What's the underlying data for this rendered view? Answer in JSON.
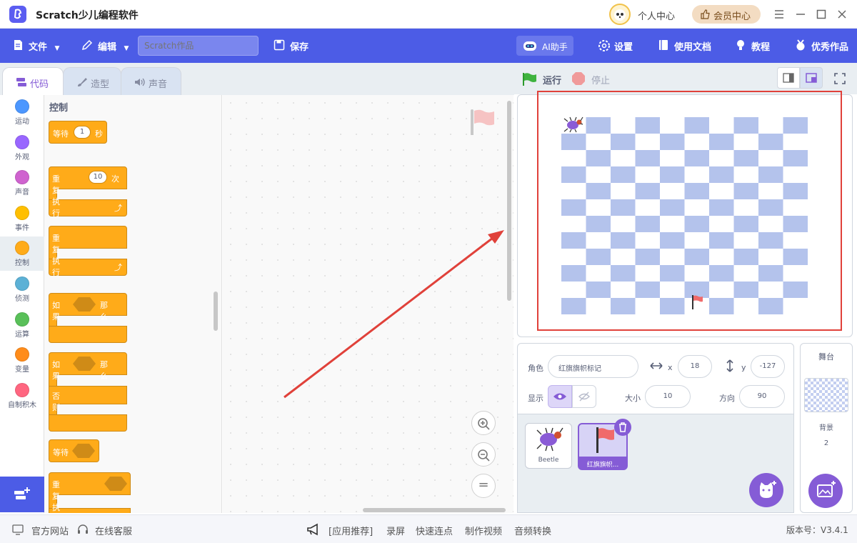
{
  "titlebar": {
    "app_title": "Scratch少儿编程软件",
    "user_center": "个人中心",
    "vip_center": "会员中心"
  },
  "menubar": {
    "file": "文件",
    "edit": "编辑",
    "project_name_placeholder": "Scratch作品",
    "save": "保存",
    "ai_assistant": "AI助手",
    "settings": "设置",
    "docs": "使用文档",
    "tutorial": "教程",
    "showcase": "优秀作品"
  },
  "tabs": [
    {
      "label": "代码"
    },
    {
      "label": "造型"
    },
    {
      "label": "声音"
    }
  ],
  "categories": [
    {
      "label": "运动",
      "color": "#4c97ff"
    },
    {
      "label": "外观",
      "color": "#9966ff"
    },
    {
      "label": "声音",
      "color": "#cf63cf"
    },
    {
      "label": "事件",
      "color": "#ffbf00"
    },
    {
      "label": "控制",
      "color": "#ffab19"
    },
    {
      "label": "侦测",
      "color": "#5cb1d6"
    },
    {
      "label": "运算",
      "color": "#59c059"
    },
    {
      "label": "变量",
      "color": "#ff8c1a"
    },
    {
      "label": "自制积木",
      "color": "#ff6680"
    }
  ],
  "palette": {
    "title": "控制",
    "wait_label": "等待",
    "wait_value": "1",
    "wait_unit": "秒",
    "repeat_label": "重复执行",
    "repeat_value": "10",
    "repeat_unit": "次",
    "forever_label": "重复执行",
    "if_label": "如果",
    "then_label": "那么",
    "else_label": "否则",
    "wait_until_label": "等待",
    "repeat_until_label": "重复执行直到"
  },
  "code_area": {
    "zoom_in": "+",
    "zoom_out": "−",
    "zoom_reset": "="
  },
  "stage_header": {
    "run": "运行",
    "stop": "停止"
  },
  "sprite_info": {
    "sprite_label": "角色",
    "sprite_name": "红旗旗帜标记",
    "x_label": "x",
    "x_value": "18",
    "y_label": "y",
    "y_value": "-127",
    "show_label": "显示",
    "size_label": "大小",
    "size_value": "10",
    "direction_label": "方向",
    "direction_value": "90"
  },
  "sprites": [
    {
      "name": "Beetle"
    },
    {
      "name": "红旗旗帜..."
    }
  ],
  "stage_panel": {
    "title": "舞台",
    "backdrop_label": "背景",
    "backdrop_count": "2"
  },
  "bottombar": {
    "official_site": "官方网站",
    "online_service": "在线客服",
    "app_recommend": "[应用推荐]",
    "screen_record": "录屏",
    "quick_connect": "快速连点",
    "make_video": "制作视频",
    "audio_convert": "音频转换",
    "version": "版本号：V3.4.1"
  },
  "colors": {
    "accent": "#4c5ce6",
    "highlight": "#e0413a",
    "checker": "#b4c3ec"
  }
}
